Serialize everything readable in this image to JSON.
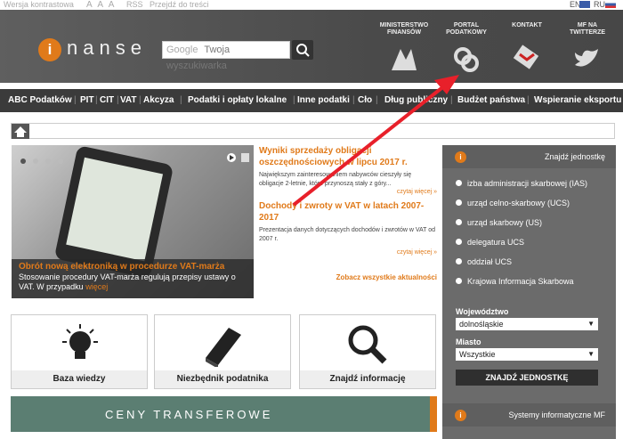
{
  "topbar": {
    "contrast": "Wersja kontrastowa",
    "font_sizes": "A A A",
    "rss": "RSS",
    "skip": "Przejdź do treści",
    "lang_en": "EN",
    "lang_ru": "RU"
  },
  "logo": {
    "letter": "i",
    "text": "nanse"
  },
  "search": {
    "google": "Google",
    "placeholder": "Twoja wyszukiwarka"
  },
  "header_links": [
    {
      "label": "MINISTERSTWO FINANSÓW"
    },
    {
      "label": "PORTAL PODATKOWY"
    },
    {
      "label": "KONTAKT"
    },
    {
      "label": "MF NA TWITTERZE"
    }
  ],
  "nav": {
    "items": [
      "ABC Podatków",
      "PIT",
      "CIT",
      "VAT",
      "Akcyza",
      "Podatki i opłaty lokalne",
      "Inne podatki",
      "Cło",
      "Dług publiczny",
      "Budżet państwa",
      "Wspieranie eksportu"
    ]
  },
  "slider": {
    "title": "Obrót nową elektroniką w procedurze VAT-marża",
    "text": "Stosowanie procedury VAT-marża regulują przepisy ustawy o VAT. W przypadku",
    "more": "więcej"
  },
  "news": [
    {
      "title": "Wyniki sprzedaży obligacji oszczędnościowych w lipcu 2017 r.",
      "text": "Największym zainteresowaniem nabywców cieszyły się obligacje 2-letnie, które przynoszą stały z góry...",
      "more": "czytaj więcej »"
    },
    {
      "title": "Dochody i zwroty w VAT w latach 2007-2017",
      "text": "Prezentacja danych dotyczących dochodów i zwrotów w VAT od 2007 r.",
      "more": "czytaj więcej »"
    }
  ],
  "all_news": "Zobacz wszystkie aktualności",
  "tiles": [
    {
      "label": "Baza wiedzy"
    },
    {
      "label": "Niezbędnik podatnika"
    },
    {
      "label": "Znajdź informację"
    }
  ],
  "banner": {
    "text": "CENY TRANSFEROWE"
  },
  "right_panel": {
    "title": "Znajdź jednostkę",
    "options": [
      "izba administracji skarbowej (IAS)",
      "urząd celno-skarbowy (UCS)",
      "urząd skarbowy (US)",
      "delegatura UCS",
      "oddział UCS",
      "Krajowa Informacja Skarbowa"
    ],
    "voiv_label": "Województwo",
    "voiv_value": "dolnośląskie",
    "city_label": "Miasto",
    "city_value": "Wszystkie",
    "button": "ZNAJDŹ JEDNOSTKĘ",
    "bottom_title": "Systemy informatyczne MF"
  },
  "colors": {
    "accent": "#e07a1a",
    "header_bg": "#4f4f4f",
    "panel_bg": "#6b6b6b",
    "arrow": "#e8202a"
  }
}
